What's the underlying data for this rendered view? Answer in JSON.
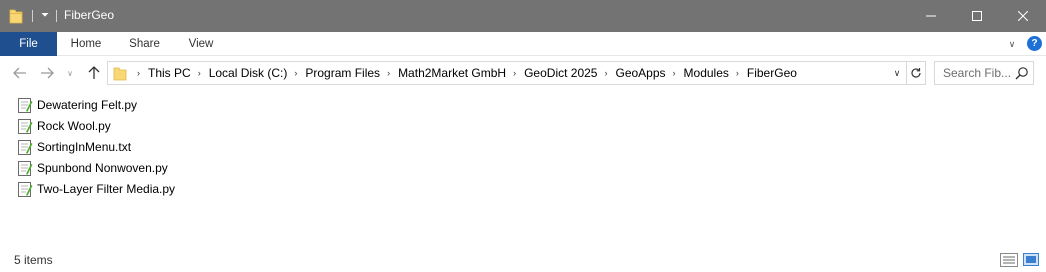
{
  "window": {
    "title": "FiberGeo",
    "quick_access_glyph": "⏷"
  },
  "ribbon": {
    "tabs": [
      {
        "label": "File"
      },
      {
        "label": "Home"
      },
      {
        "label": "Share"
      },
      {
        "label": "View"
      }
    ],
    "expand_glyph": "∨",
    "help_glyph": "?"
  },
  "navigation": {
    "recent_glyph": "∨",
    "breadcrumbs": [
      "This PC",
      "Local Disk (C:)",
      "Program Files",
      "Math2Market GmbH",
      "GeoDict 2025",
      "GeoApps",
      "Modules",
      "FiberGeo"
    ],
    "separator_glyph": "›",
    "dropdown_glyph": "∨",
    "search": {
      "placeholder": "Search Fib...",
      "value": ""
    }
  },
  "files": [
    {
      "name": "Dewatering Felt.py",
      "icon": "python-file-icon"
    },
    {
      "name": "Rock Wool.py",
      "icon": "python-file-icon"
    },
    {
      "name": "SortingInMenu.txt",
      "icon": "text-file-icon"
    },
    {
      "name": "Spunbond Nonwoven.py",
      "icon": "python-file-icon"
    },
    {
      "name": "Two-Layer Filter Media.py",
      "icon": "python-file-icon"
    }
  ],
  "status": {
    "item_count": "5 items"
  },
  "colors": {
    "titlebar": "#737373",
    "file_tab": "#1f4f8f",
    "help_accent": "#1e6fd6",
    "folder": "#f8d775"
  }
}
